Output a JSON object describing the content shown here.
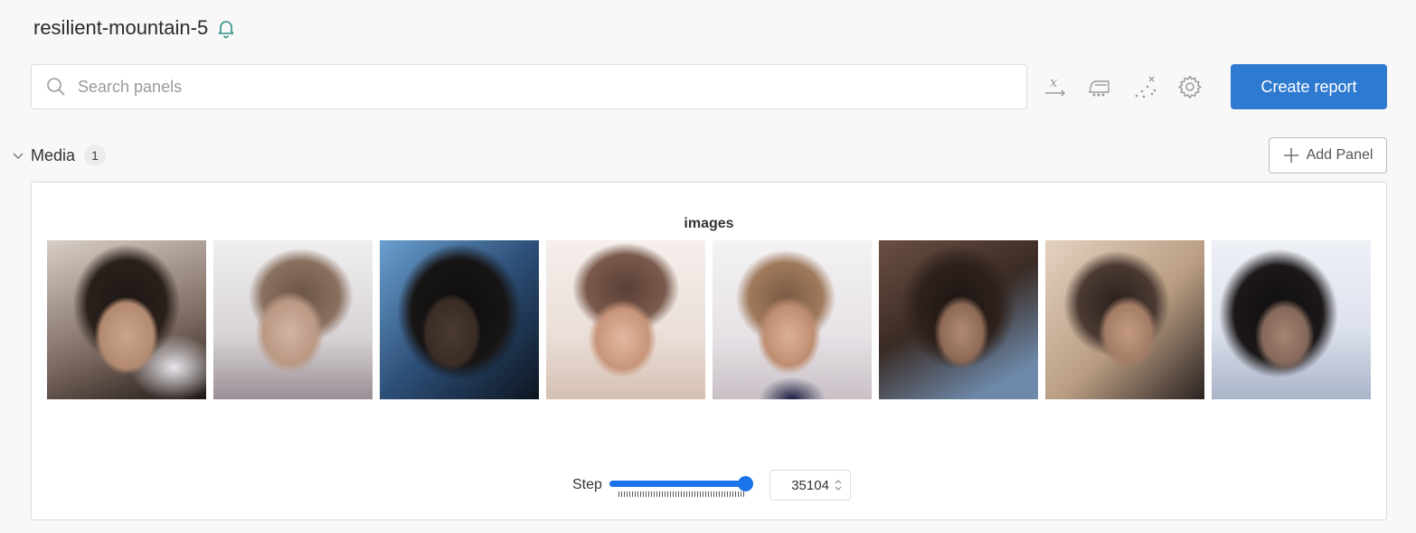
{
  "run": {
    "title": "resilient-mountain-5",
    "icon": "bell-icon"
  },
  "search": {
    "placeholder": "Search panels",
    "value": ""
  },
  "toolbar": {
    "icons": [
      "x-axis-icon",
      "smoothing-iron-icon",
      "outliers-icon",
      "gear-icon"
    ],
    "create_report_label": "Create report"
  },
  "section": {
    "title": "Media",
    "count": "1",
    "add_panel_label": "Add Panel"
  },
  "panel": {
    "title": "images",
    "step_label": "Step",
    "step_value": "35104",
    "slider_position": 1.0
  },
  "colors": {
    "accent": "#2f7ad1",
    "slider": "#1a73e8",
    "bell": "#2a8f82",
    "background": "#f8f8f8"
  }
}
